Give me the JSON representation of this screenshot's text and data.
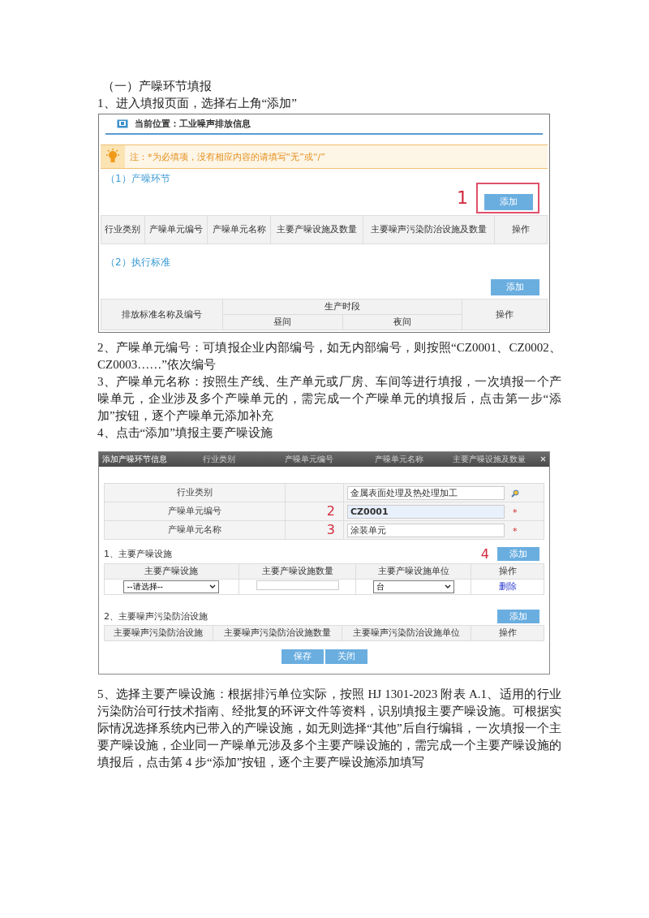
{
  "heading": "（一）产噪环节填报",
  "step1": "1、进入填报页面，选择右上角“添加”",
  "screen1": {
    "location": "当前位置：工业噪声排放信息",
    "notice": "注：*为必填项，没有相应内容的请填写“无”或“/”",
    "section1": {
      "title": "（1）产噪环节",
      "marker": "1",
      "add": "添加",
      "columns": [
        "行业类别",
        "产噪单元编号",
        "产噪单元名称",
        "主要产噪设施及数量",
        "主要噪声污染防治设施及数量",
        "操作"
      ]
    },
    "section2": {
      "title": "（2）执行标准",
      "add": "添加",
      "name_column": "排放标准名称及编号",
      "group_column": "生产时段",
      "sub_columns": [
        "昼间",
        "夜间"
      ],
      "action_column": "操作"
    }
  },
  "paragraphs": [
    "2、产噪单元编号：可填报企业内部编号，如无内部编号，则按照“CZ0001、CZ0002、CZ0003……”依次编号",
    "3、产噪单元名称：按照生产线、生产单元或厂房、车间等进行填报，一次填报一个产噪单元，企业涉及多个产噪单元的，需完成一个产噪单元的填报后，点击第一步“添加”按钮，逐个产噪单元添加补充",
    "4、点击“添加”填报主要产噪设施"
  ],
  "screen2": {
    "title": "添加产噪环节信息",
    "ghost_columns": [
      "行业类别",
      "产噪单元编号",
      "产噪单元名称",
      "主要产噪设施及数量"
    ],
    "fields": [
      {
        "label": "行业类别",
        "value": "金属表面处理及热处理加工",
        "kind": "lookup",
        "highlighted": false
      },
      {
        "label": "产噪单元编号",
        "marker": "2",
        "value": "CZ0001",
        "kind": "required",
        "mark": "*",
        "highlighted": true
      },
      {
        "label": "产噪单元名称",
        "marker": "3",
        "value": "涂装单元",
        "kind": "required",
        "mark": "*",
        "highlighted": false
      }
    ],
    "section1": {
      "title": "1、主要产噪设施",
      "marker": "4",
      "add": "添加",
      "columns": [
        "主要产噪设施",
        "主要产噪设施数量",
        "主要产噪设施单位",
        "操作"
      ],
      "row": {
        "facility": "--请选择--",
        "unit": "台",
        "action": "删除"
      }
    },
    "section2": {
      "title": "2、主要噪声污染防治设施",
      "add": "添加",
      "columns": [
        "主要噪声污染防治设施",
        "主要噪声污染防治设施数量",
        "主要噪声污染防治设施单位",
        "操作"
      ]
    },
    "buttons": [
      "保存",
      "关闭"
    ]
  },
  "paragraph5": "5、选择主要产噪设施：根据排污单位实际，按照 HJ 1301-2023 附表 A.1、适用的行业污染防治可行技术指南、经批复的环评文件等资料，识别填报主要产噪设施。可根据实际情况选择系统内已带入的产噪设施，如无则选择“其他”后自行编辑，一次填报一个主要产噪设施，企业同一产噪单元涉及多个主要产噪设施的，需完成一个主要产噪设施的填报后，点击第 4 步“添加”按钮，逐个主要产噪设施添加填写"
}
